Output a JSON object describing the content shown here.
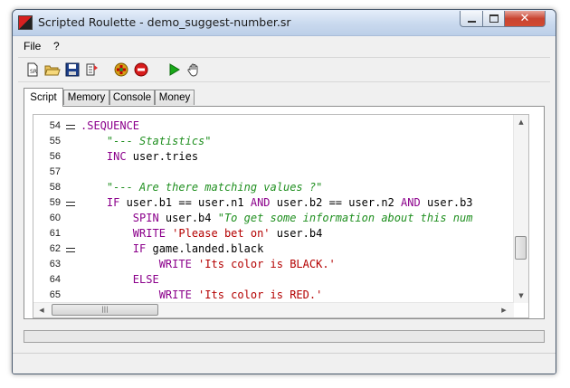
{
  "window": {
    "title": "Scripted Roulette - demo_suggest-number.sr",
    "close_glyph": "✕",
    "minimize_glyph": "▭",
    "maximize_glyph": "□"
  },
  "menu": {
    "items": [
      "File",
      "?"
    ]
  },
  "toolbar": {
    "buttons": [
      {
        "icon": "new-script-icon"
      },
      {
        "icon": "open-folder-icon"
      },
      {
        "icon": "save-disk-icon"
      },
      {
        "icon": "export-icon"
      },
      {
        "icon": "add-chips-icon"
      },
      {
        "icon": "stop-icon"
      },
      {
        "icon": "play-icon"
      },
      {
        "icon": "hand-icon"
      }
    ]
  },
  "tabs": [
    "Script",
    "Memory",
    "Console",
    "Money"
  ],
  "active_tab": "Script",
  "editor": {
    "lines": [
      {
        "num": "54",
        "fold": true,
        "parts": [
          {
            "t": ".SEQUENCE",
            "c": "kw"
          }
        ]
      },
      {
        "num": "55",
        "fold": false,
        "parts": [
          {
            "t": "    \"--- Statistics\"",
            "c": "cmt"
          }
        ]
      },
      {
        "num": "56",
        "fold": false,
        "parts": [
          {
            "t": "    INC ",
            "c": "kw"
          },
          {
            "t": "user.tries",
            "c": "plain"
          }
        ]
      },
      {
        "num": "57",
        "fold": false,
        "parts": []
      },
      {
        "num": "58",
        "fold": false,
        "parts": [
          {
            "t": "    \"--- Are there matching values ?\"",
            "c": "cmt"
          }
        ]
      },
      {
        "num": "59",
        "fold": true,
        "parts": [
          {
            "t": "    IF ",
            "c": "kw"
          },
          {
            "t": "user.b1 == user.n1 ",
            "c": "plain"
          },
          {
            "t": "AND ",
            "c": "kw"
          },
          {
            "t": "user.b2 == user.n2 ",
            "c": "plain"
          },
          {
            "t": "AND ",
            "c": "kw"
          },
          {
            "t": "user.b3",
            "c": "plain"
          }
        ]
      },
      {
        "num": "60",
        "fold": false,
        "parts": [
          {
            "t": "        SPIN ",
            "c": "kw"
          },
          {
            "t": "user.b4 ",
            "c": "plain"
          },
          {
            "t": "\"To get some information about this num",
            "c": "cmt"
          }
        ]
      },
      {
        "num": "61",
        "fold": false,
        "parts": [
          {
            "t": "        WRITE ",
            "c": "kw"
          },
          {
            "t": "'Please bet on' ",
            "c": "str"
          },
          {
            "t": "user.b4",
            "c": "plain"
          }
        ]
      },
      {
        "num": "62",
        "fold": true,
        "parts": [
          {
            "t": "        IF ",
            "c": "kw"
          },
          {
            "t": "game.landed.black",
            "c": "plain"
          }
        ]
      },
      {
        "num": "63",
        "fold": false,
        "parts": [
          {
            "t": "            WRITE ",
            "c": "kw"
          },
          {
            "t": "'Its color is BLACK.'",
            "c": "str"
          }
        ]
      },
      {
        "num": "64",
        "fold": false,
        "parts": [
          {
            "t": "        ELSE",
            "c": "kw"
          }
        ]
      },
      {
        "num": "65",
        "fold": false,
        "parts": [
          {
            "t": "            WRITE ",
            "c": "kw"
          },
          {
            "t": "'Its color is RED.'",
            "c": "str"
          }
        ]
      }
    ]
  },
  "colors": {
    "keyword": "#8b008b",
    "comment": "#1f8f1f",
    "string": "#b40000"
  }
}
